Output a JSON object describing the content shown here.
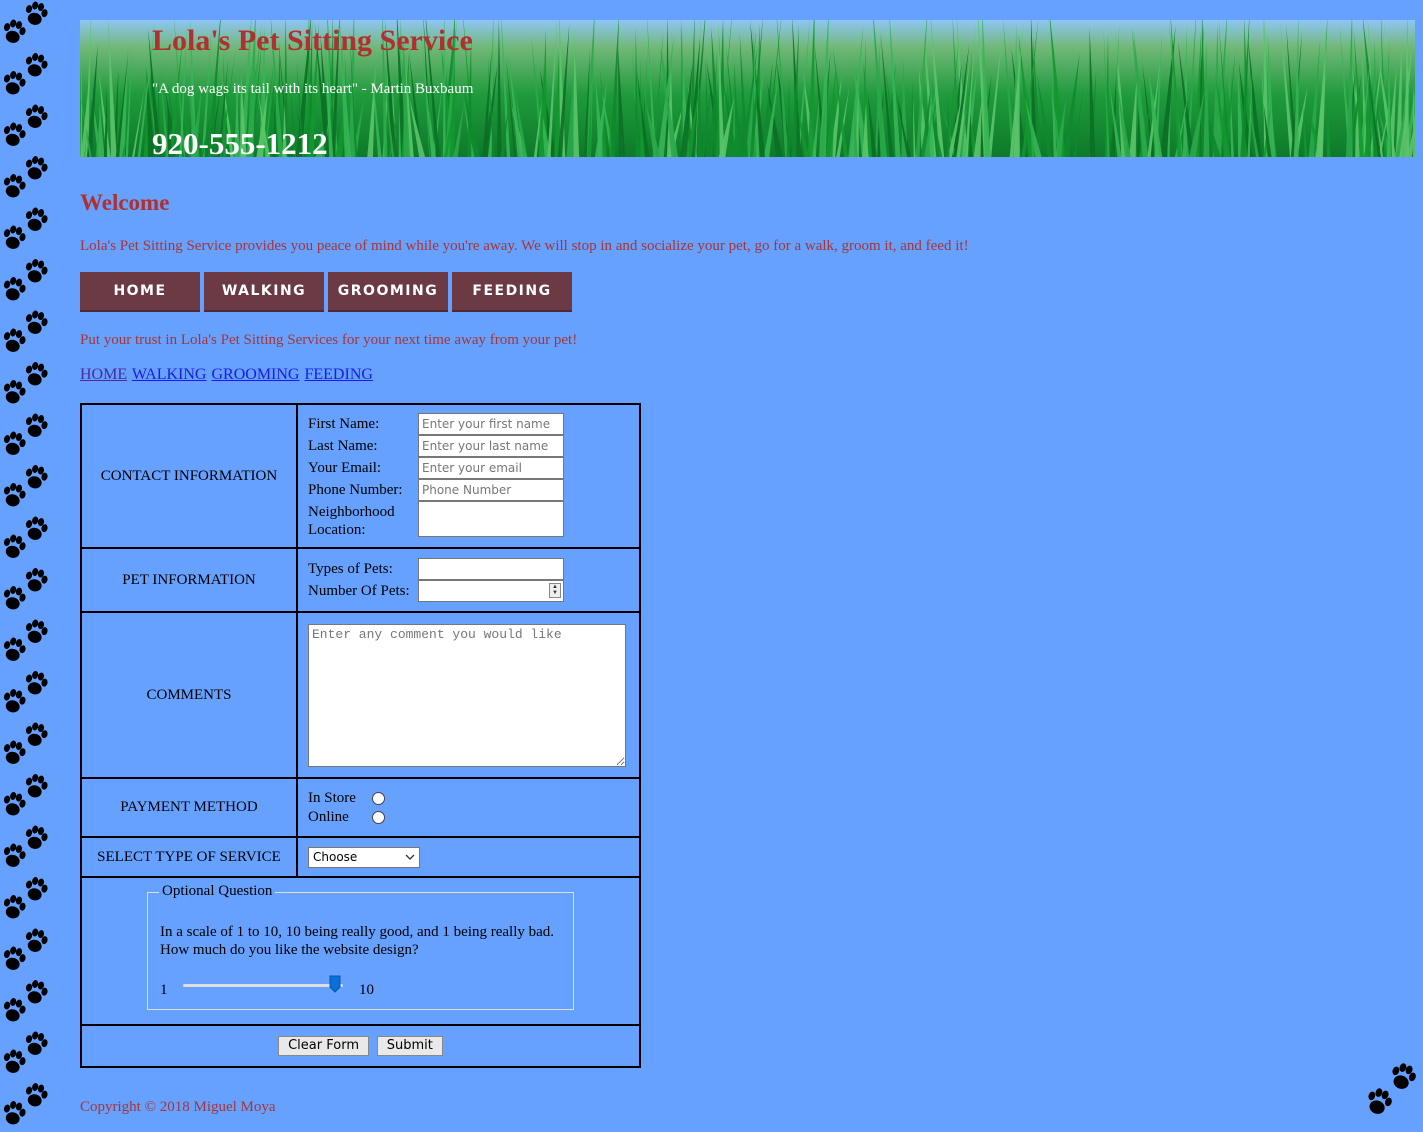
{
  "header": {
    "title": "Lola's Pet Sitting Service",
    "quote": "\"A dog wags its tail with its heart\" - Martin Buxbaum",
    "phone": "920-555-1212"
  },
  "welcome": {
    "heading": "Welcome",
    "text": "Lola's Pet Sitting Service provides you peace of mind while you're away. We will stop in and socialize your pet, go for a walk, groom it, and feed it!"
  },
  "nav": {
    "buttons": [
      "HOME",
      "WALKING",
      "GROOMING",
      "FEEDING"
    ],
    "links": [
      "HOME",
      "WALKING",
      "GROOMING",
      "FEEDING"
    ]
  },
  "trust_text": "Put your trust in Lola's Pet Sitting Services for your next time away from your pet!",
  "form": {
    "contact": {
      "section_label": "CONTACT INFORMATION",
      "first_name_label": "First Name:",
      "first_name_placeholder": "Enter your first name",
      "last_name_label": "Last Name:",
      "last_name_placeholder": "Enter your last name",
      "email_label": "Your Email:",
      "email_placeholder": "Enter your email",
      "phone_label": "Phone Number:",
      "phone_placeholder": "Phone Number",
      "neighborhood_label": "Neighborhood Location:"
    },
    "pet": {
      "section_label": "PET INFORMATION",
      "types_label": "Types of Pets:",
      "number_label": "Number Of Pets:"
    },
    "comments": {
      "section_label": "COMMENTS",
      "placeholder": "Enter any comment you would like"
    },
    "payment": {
      "section_label": "PAYMENT METHOD",
      "options": [
        "In Store",
        "Online"
      ]
    },
    "service": {
      "section_label": "SELECT TYPE OF SERVICE",
      "selected": "Choose"
    },
    "optional": {
      "legend": "Optional Question",
      "question": "In a scale of 1 to 10, 10 being really good, and 1 being really bad. How much do you like the website design?",
      "min_label": "1",
      "max_label": "10",
      "slider_value_fraction": 0.95
    },
    "buttons": {
      "clear": "Clear Form",
      "submit": "Submit"
    }
  },
  "footer": {
    "copyright": "Copyright © 2018 Miguel Moya"
  },
  "colors": {
    "background": "#66a1ff",
    "title_red": "#b03030",
    "nav_button": "#6b3a44",
    "link_blue": "#1a1aee"
  }
}
